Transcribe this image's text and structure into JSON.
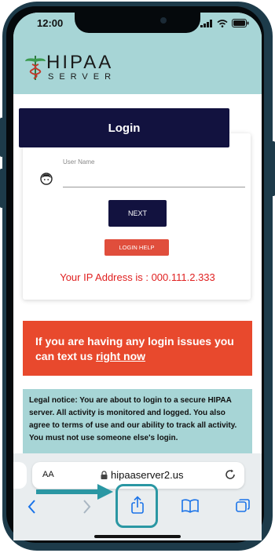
{
  "status": {
    "time": "12:00"
  },
  "logo": {
    "line1": "HIPAA",
    "line2": "SERVER"
  },
  "login": {
    "title": "Login",
    "username_label": "User Name",
    "next_label": "NEXT",
    "help_label": "LOGIN HELP",
    "ip_text": "Your IP Address is : 000.111.2.333"
  },
  "alert": {
    "line1": "If you are having any login issues you",
    "line2_prefix": "can text us ",
    "link": "right now"
  },
  "legal": {
    "text": "Legal notice: You are about to login to a secure HIPAA server. All activity is monitored and logged. You also agree to terms of use and our ability to track all activity. You must not use someone else's login."
  },
  "browser": {
    "aa": "AA",
    "url": "hipaaserver2.us"
  },
  "colors": {
    "navy": "#12123f",
    "red": "#e8492d",
    "teal": "#a7d5d6",
    "ios_blue": "#1a73e8",
    "highlight": "#2a97a3"
  },
  "icons": [
    "caduceus-icon",
    "user-avatar-icon",
    "lock-icon",
    "reload-icon",
    "back-icon",
    "forward-icon",
    "share-icon",
    "bookmarks-icon",
    "tabs-icon",
    "pointer-arrow-icon"
  ]
}
